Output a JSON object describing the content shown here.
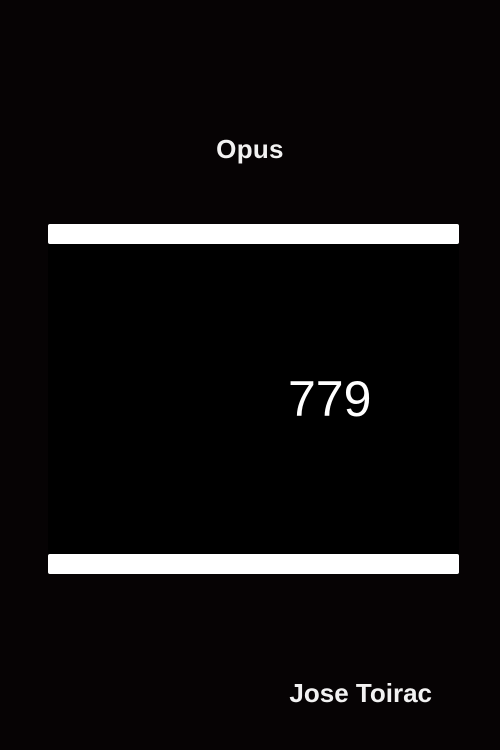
{
  "cover": {
    "title": "Opus",
    "number": "779",
    "author": "Jose Toirac",
    "colors": {
      "background": "#060304",
      "bars": "#ffffff",
      "text": "#f2f2f2"
    }
  }
}
